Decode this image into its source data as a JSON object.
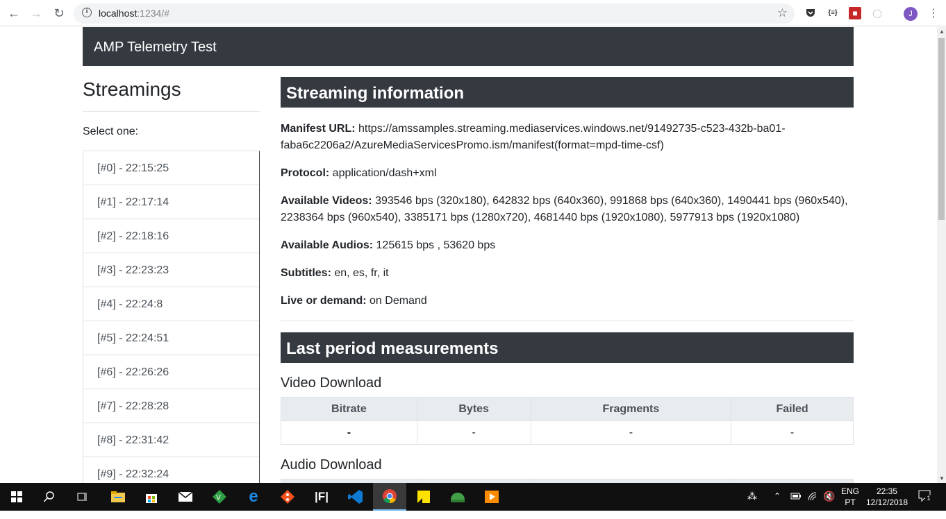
{
  "browser": {
    "url_host": "localhost",
    "url_rest": ":1234/#",
    "avatar_initial": "J",
    "ext_braces": "{≡}"
  },
  "navbar": {
    "brand": "AMP Telemetry Test"
  },
  "sidebar": {
    "title": "Streamings",
    "select_label": "Select one:",
    "items": [
      "[#0] - 22:15:25",
      "[#1] - 22:17:14",
      "[#2] - 22:18:16",
      "[#3] - 22:23:23",
      "[#4] - 22:24:8",
      "[#5] - 22:24:51",
      "[#6] - 22:26:26",
      "[#7] - 22:28:28",
      "[#8] - 22:31:42",
      "[#9] - 22:32:24"
    ]
  },
  "streaming_info": {
    "header": "Streaming information",
    "manifest_label": "Manifest URL:",
    "manifest_value": "https://amssamples.streaming.mediaservices.windows.net/91492735-c523-432b-ba01-faba6c2206a2/AzureMediaServicesPromo.ism/manifest(format=mpd-time-csf)",
    "protocol_label": "Protocol:",
    "protocol_value": "application/dash+xml",
    "videos_label": "Available Videos:",
    "videos_value": "393546 bps (320x180), 642832 bps (640x360), 991868 bps (640x360), 1490441 bps (960x540), 2238364 bps (960x540), 3385171 bps (1280x720), 4681440 bps (1920x1080), 5977913 bps (1920x1080)",
    "audios_label": "Available Audios:",
    "audios_value": "125615 bps , 53620 bps",
    "subtitles_label": "Subtitles:",
    "subtitles_value": "en, es, fr, it",
    "live_label": "Live or demand:",
    "live_value": "on Demand"
  },
  "measurements": {
    "header": "Last period measurements",
    "video_title": "Video Download",
    "audio_title": "Audio Download",
    "columns": [
      "Bitrate",
      "Bytes",
      "Fragments",
      "Failed"
    ],
    "video_row": [
      "-",
      "-",
      "-",
      "-"
    ]
  },
  "taskbar": {
    "lang": "ENG",
    "region": "PT",
    "time": "22:35",
    "date": "12/12/2018",
    "notif_count": "1"
  }
}
